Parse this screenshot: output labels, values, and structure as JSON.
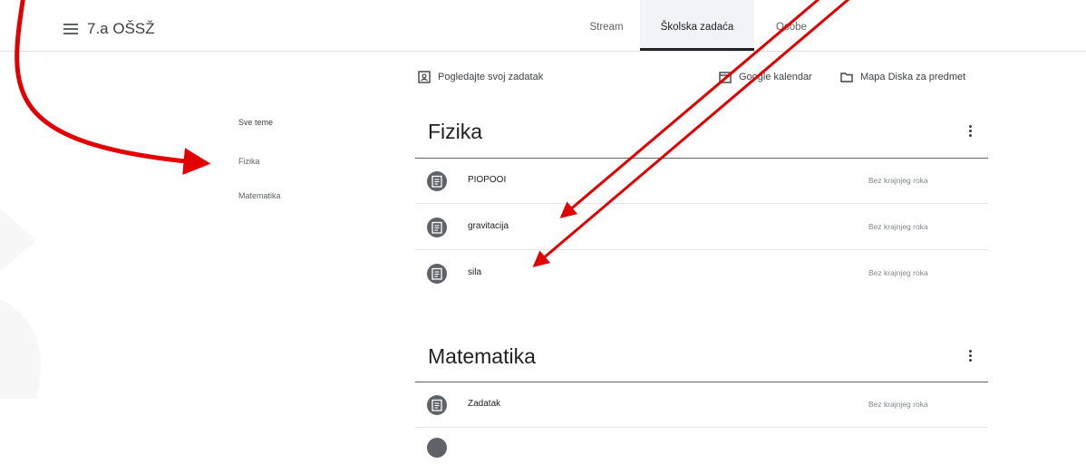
{
  "header": {
    "class_name": "7.a OŠSŽ",
    "tabs": [
      {
        "label": "Stream"
      },
      {
        "label": "Školska zadaća"
      },
      {
        "label": "Osobe"
      }
    ]
  },
  "toolbar": {
    "view_work": "Pogledajte svoj zadatak",
    "calendar": "Google kalendar",
    "drive": "Mapa Diska za predmet"
  },
  "sidebar": {
    "items": [
      {
        "label": "Sve teme"
      },
      {
        "label": "Fizika"
      },
      {
        "label": "Matematika"
      }
    ]
  },
  "topics": [
    {
      "title": "Fizika",
      "items": [
        {
          "title": "PIOPOOI",
          "due": "Bez krajnjeg roka"
        },
        {
          "title": "gravitacija",
          "due": "Bez krajnjeg roka"
        },
        {
          "title": "sila",
          "due": "Bez krajnjeg roka"
        }
      ]
    },
    {
      "title": "Matematika",
      "items": [
        {
          "title": "Zadatak",
          "due": "Bez krajnjeg roka"
        }
      ]
    }
  ],
  "colors": {
    "annotation_arrow": "#e30000",
    "accent": "#202124"
  },
  "icons": [
    "menu-icon",
    "assignment-icon",
    "calendar-icon",
    "folder-icon",
    "more-vert-icon",
    "view-work-icon"
  ]
}
